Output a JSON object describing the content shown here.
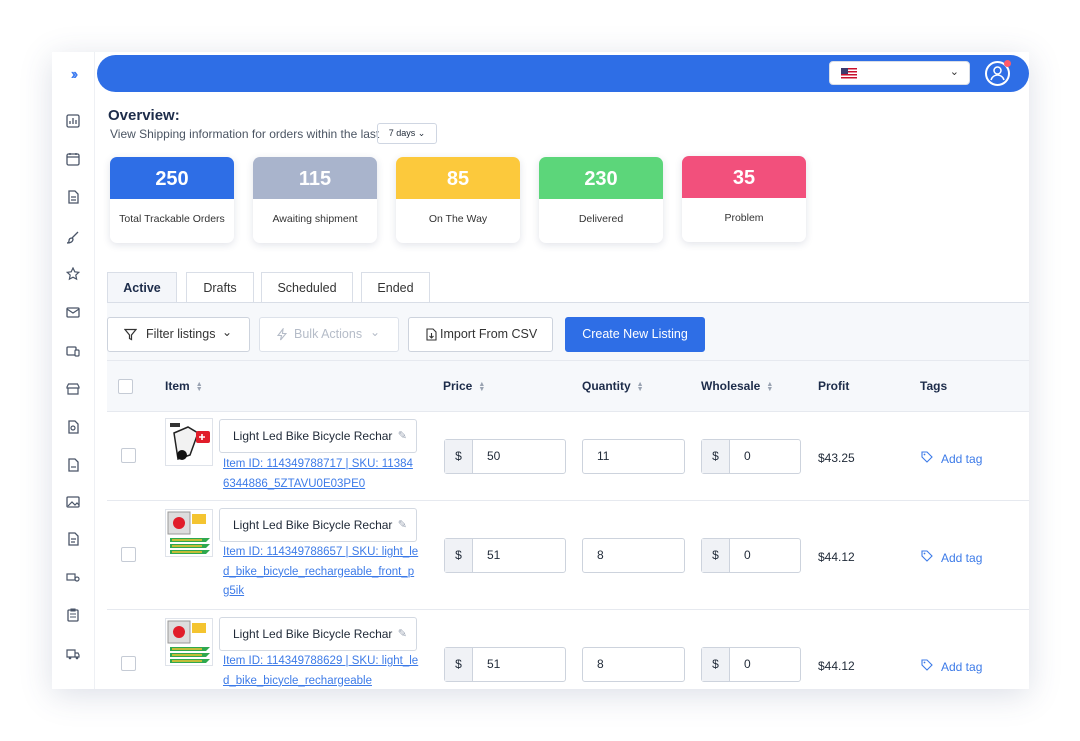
{
  "header": {
    "language_flag": "us-flag-icon"
  },
  "overview": {
    "title": "Overview:",
    "subtitle": "View Shipping information for orders within the last",
    "range": "7 days"
  },
  "stats": [
    {
      "value": "250",
      "label": "Total Trackable Orders",
      "color": "#2e6ee6"
    },
    {
      "value": "115",
      "label": "Awaiting shipment",
      "color": "#a9b4cc"
    },
    {
      "value": "85",
      "label": "On The Way",
      "color": "#fcc93c"
    },
    {
      "value": "230",
      "label": "Delivered",
      "color": "#5cd67a"
    },
    {
      "value": "35",
      "label": "Problem",
      "color": "#f2507c"
    }
  ],
  "tabs": [
    "Active",
    "Drafts",
    "Scheduled",
    "Ended"
  ],
  "toolbar": {
    "filter": "Filter listings",
    "bulk": "Bulk Actions",
    "import": "Import From CSV",
    "create": "Create New Listing"
  },
  "table": {
    "headers": {
      "item": "Item",
      "price": "Price",
      "quantity": "Quantity",
      "wholesale": "Wholesale",
      "profit": "Profit",
      "tags": "Tags"
    },
    "currency": "$",
    "add_tag": "Add tag",
    "rows": [
      {
        "title": "Light Led Bike Bicycle Rechar",
        "link": "Item ID: 114349788717 | SKU: 113846344886_5ZTAVU0E03PE0",
        "price": "50",
        "quantity": "11",
        "wholesale": "0",
        "profit": "$43.25"
      },
      {
        "title": "Light Led Bike Bicycle Rechar",
        "link": "Item ID: 114349788657 | SKU: light_led_bike_bicycle_rechargeable_front_pg5ik",
        "price": "51",
        "quantity": "8",
        "wholesale": "0",
        "profit": "$44.12"
      },
      {
        "title": "Light Led Bike Bicycle Rechar",
        "link": "Item ID: 114349788629 | SKU: light_led_bike_bicycle_rechargeable",
        "price": "51",
        "quantity": "8",
        "wholesale": "0",
        "profit": "$44.12"
      }
    ]
  }
}
